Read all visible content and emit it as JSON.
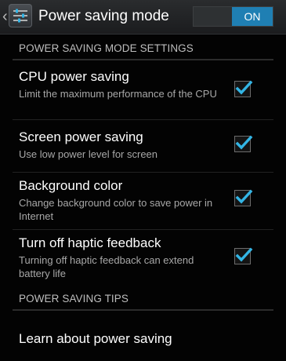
{
  "action_bar": {
    "title": "Power saving mode",
    "toggle_label": "ON",
    "up_icon": "chevron-left-icon",
    "app_icon": "sliders-settings-icon"
  },
  "sections": {
    "settings_header": "POWER SAVING MODE SETTINGS",
    "tips_header": "POWER SAVING TIPS"
  },
  "settings": [
    {
      "label": "CPU power saving",
      "summary": "Limit the maximum performance of the CPU",
      "checked": true
    },
    {
      "label": "Screen power saving",
      "summary": "Use low power level for screen",
      "checked": true
    },
    {
      "label": "Background color",
      "summary": "Change background color to save power in Internet",
      "checked": true
    },
    {
      "label": "Turn off haptic feedback",
      "summary": "Turning off haptic feedback can extend battery life",
      "checked": true
    }
  ],
  "tips": {
    "learn_label": "Learn about power saving"
  },
  "colors": {
    "accent": "#1f7fb3",
    "check": "#33b5e5",
    "background": "#030303"
  }
}
